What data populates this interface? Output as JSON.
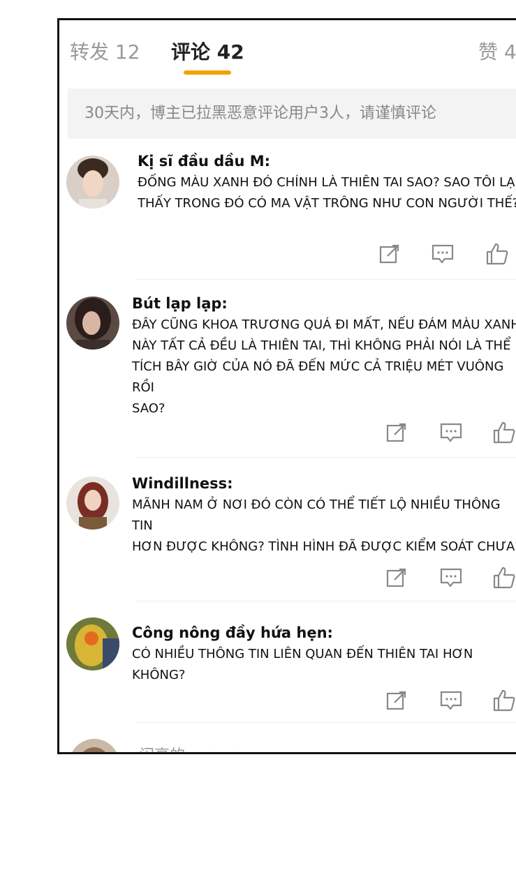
{
  "tabs": [
    {
      "label": "转发 12"
    },
    {
      "label": "评论 42"
    },
    {
      "label": "赞 4"
    }
  ],
  "notice": "30天内，博主已拉黑恶意评论用户3人，请谨慎评论",
  "comments": [
    {
      "name": "Kị sĩ đầu dầu M:",
      "text": "Đống màu xanh đó chính là thiên tai sao? Sao tôi lại\nthấy trong đó có ma vật trông như con người thế?"
    },
    {
      "name": "Bút lạp lạp:",
      "text": "Đây cũng khoa trương quá đi mất, nếu đám màu xanh\nnày tất cả đều là thiên tai, thì không phải nói là thể\ntích bây giờ của nó đã đến mức cả triệu mét vuông rồi\nsao?"
    },
    {
      "name": "Windillness:",
      "text": "Mãnh nam ở nơi đó còn có thể tiết lộ nhiều thông tin\nhơn được không? Tình hình đã được kiểm soát chưa?"
    },
    {
      "name": "Công nông đầy hứa hẹn:",
      "text": "Có nhiều thông tin liên quan đến thiên tai hơn không?"
    }
  ],
  "next_comment_name": "闪亮的yunyun",
  "colors": {
    "accent": "#f0a400",
    "icon": "#888888",
    "notice_bg": "#f3f3f3"
  },
  "icons": [
    "share-icon",
    "comment-icon",
    "like-icon"
  ]
}
